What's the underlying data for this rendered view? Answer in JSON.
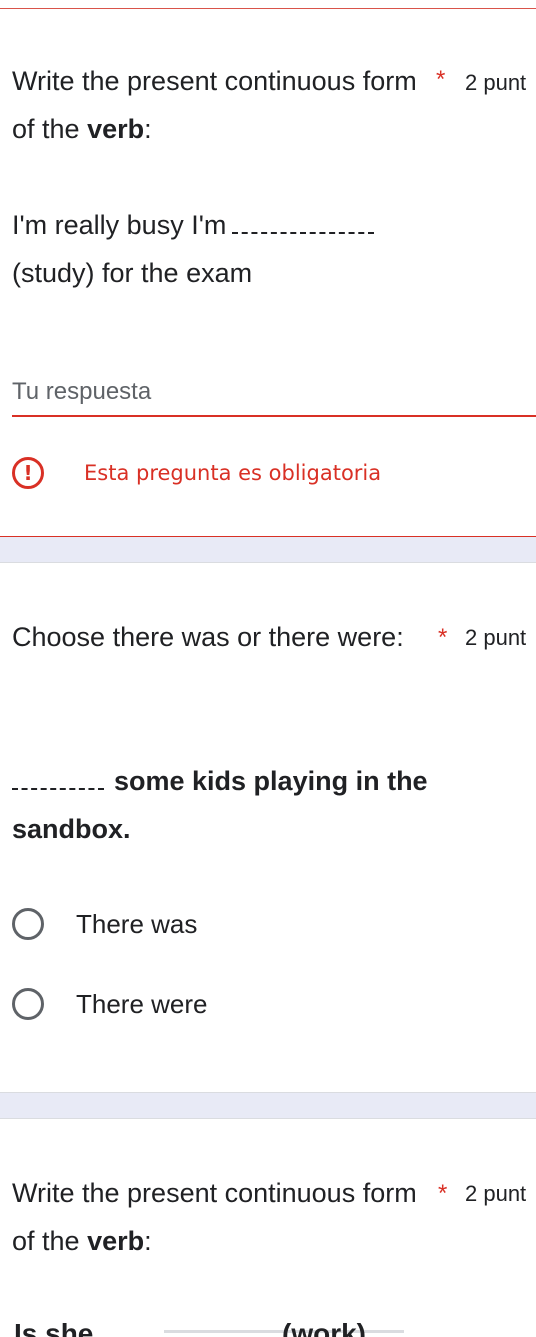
{
  "questions": [
    {
      "title_prefix": "Write the present continuous form of the ",
      "title_bold": "verb",
      "title_suffix": ":",
      "required": "*",
      "points": "2 punt",
      "body_prefix": "I'm really busy I'm",
      "body_suffix": "(study) for the exam",
      "answer_placeholder": "Tu respuesta",
      "error_text": "Esta pregunta es obligatoria"
    },
    {
      "title": "Choose there was or there were:",
      "required": "*",
      "points": "2 punt",
      "body_bold": "some kids playing in the sandbox.",
      "options": [
        "There was",
        "There were"
      ]
    },
    {
      "title_prefix": "Write the present continuous form of the ",
      "title_bold": "verb",
      "title_suffix": ":",
      "required": "*",
      "points": "2 punt",
      "body_partial_start": "Is she",
      "body_partial_verb": "(work)"
    }
  ]
}
